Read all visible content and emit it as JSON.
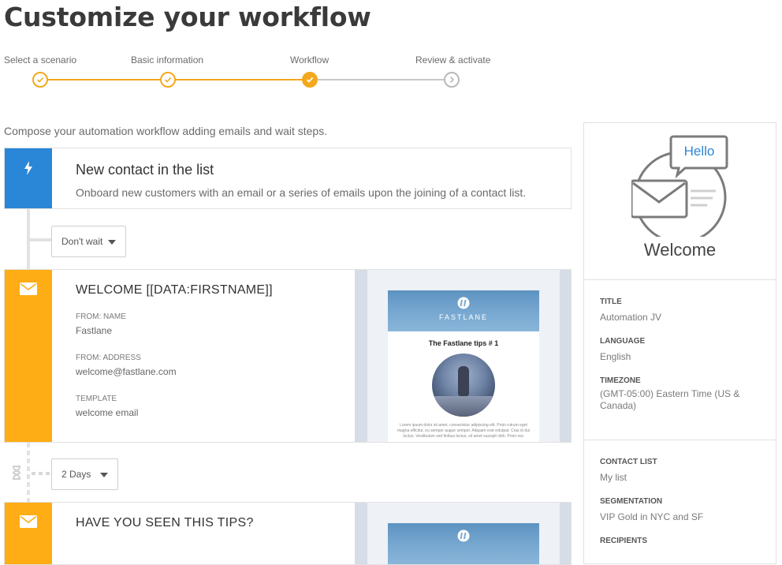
{
  "page": {
    "title": "Customize your workflow",
    "intro": "Compose your automation workflow adding emails and wait steps."
  },
  "stepper": {
    "steps": [
      {
        "label": "Select a scenario",
        "state": "done"
      },
      {
        "label": "Basic information",
        "state": "done"
      },
      {
        "label": "Workflow",
        "state": "current"
      },
      {
        "label": "Review & activate",
        "state": "todo"
      }
    ],
    "accent_color": "#f4a81d",
    "inactive_color": "#b9b9b9"
  },
  "trigger": {
    "title": "New contact in the list",
    "description": "Onboard new customers with an email or a series of emails upon the joining of a contact list.",
    "icon": "lightning-icon",
    "color": "#2a86d6"
  },
  "waits": [
    {
      "value": "Don't wait"
    },
    {
      "value": "2 Days"
    }
  ],
  "emails": [
    {
      "title": "WELCOME [[DATA:FIRSTNAME]]",
      "from_name_label": "FROM: NAME",
      "from_name": "Fastlane",
      "from_address_label": "FROM: ADDRESS",
      "from_address": "welcome@fastlane.com",
      "template_label": "TEMPLATE",
      "template": "welcome email",
      "icon": "envelope-icon",
      "color": "#ffad14",
      "preview": {
        "brand": "FASTLANE",
        "heading": "The Fastlane tips # 1",
        "body": "Lorem ipsum dolor sit amet, consectetur adipiscing elit. Proin rutrum eget magna efficitur, eu semper augue semper. Aliquam erat volutpat. Cras id dui lectus. Vestibulum sed finibus lectus, sit amet suscipit nibh. Proin nec"
      }
    },
    {
      "title": "HAVE YOU SEEN THIS TIPS?",
      "icon": "envelope-icon",
      "color": "#ffad14"
    }
  ],
  "sidebar": {
    "bubble_text": "Hello",
    "heading": "Welcome",
    "fields": [
      {
        "label": "TITLE",
        "value": "Automation JV"
      },
      {
        "label": "LANGUAGE",
        "value": "English"
      },
      {
        "label": "TIMEZONE",
        "value": "(GMT-05:00) Eastern Time (US & Canada)"
      }
    ],
    "fields2": [
      {
        "label": "CONTACT LIST",
        "value": "My list"
      },
      {
        "label": "SEGMENTATION",
        "value": "VIP Gold in NYC and SF"
      },
      {
        "label": "RECIPIENTS",
        "value": ""
      }
    ]
  }
}
